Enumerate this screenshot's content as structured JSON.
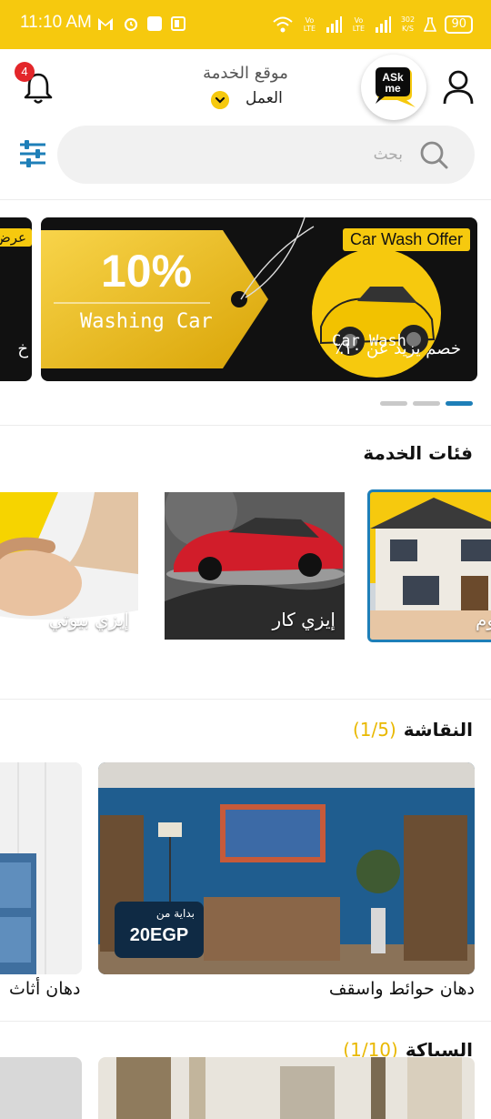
{
  "status_bar": {
    "time": "11:10 AM",
    "battery": "90",
    "lte1": "Vo LTE",
    "lte2": "Vo LTE",
    "speed": "302 K/S"
  },
  "header": {
    "notification_count": "4",
    "location_title": "موقع الخدمة",
    "location_value": "العمل",
    "logo_text_top": "ASk",
    "logo_text_bottom": "me"
  },
  "search": {
    "placeholder": "بحث"
  },
  "banners": {
    "main": {
      "discount_percent": "10%",
      "tag_text": "Washing Car",
      "offer_label": "Car Wash Offer",
      "wash_text": "Car Wash",
      "discount_text": "خصم يزيد عن ١٠٪"
    },
    "previous": {
      "label": "عرض",
      "text": "خ"
    },
    "pagination": {
      "count": 3,
      "active_index": 2
    }
  },
  "categories": {
    "title": "فئات الخدمة",
    "items": [
      {
        "label": "يوم"
      },
      {
        "label": "إيزي كار"
      },
      {
        "label": "إيزي بيوتي"
      }
    ]
  },
  "painting_section": {
    "title": "النقاشة",
    "count": "(1/5)",
    "items": [
      {
        "label": "دهان حوائط واسقف",
        "price_from": "بداية من",
        "price": "20EGP"
      },
      {
        "label": "دهان أثاث"
      }
    ]
  },
  "plumbing_section": {
    "title": "السباكة",
    "count": "(1/10)"
  },
  "colors": {
    "accent": "#f6c90e",
    "active_blue": "#1e7fb8",
    "badge_red": "#e3262a",
    "price_bg": "#0f2a44"
  }
}
